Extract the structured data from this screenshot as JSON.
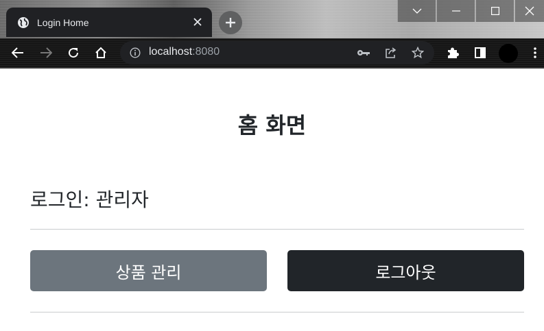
{
  "browser": {
    "tab_title": "Login Home",
    "url_host": "localhost",
    "url_port": ":8080",
    "icons": {
      "favicon": "globe-icon",
      "tab_close": "close-icon",
      "new_tab": "plus-icon",
      "window_controls": [
        "chevron-down-icon",
        "minimize-icon",
        "maximize-icon",
        "close-icon"
      ],
      "nav": [
        "back-arrow-icon",
        "forward-arrow-icon",
        "reload-icon",
        "home-icon"
      ],
      "omnibox": [
        "info-icon",
        "key-icon",
        "share-icon",
        "star-icon"
      ],
      "right": [
        "puzzle-icon",
        "side-panel-icon",
        "avatar",
        "more-vert-icon"
      ]
    }
  },
  "page": {
    "title": "홈 화면",
    "login_status": "로그인: 관리자",
    "buttons": {
      "items": "상품 관리",
      "logout": "로그아웃"
    }
  },
  "colors": {
    "secondary_button": "#6c757d",
    "dark_button": "#212529",
    "text": "#212529",
    "divider": "#c9cbcd"
  }
}
